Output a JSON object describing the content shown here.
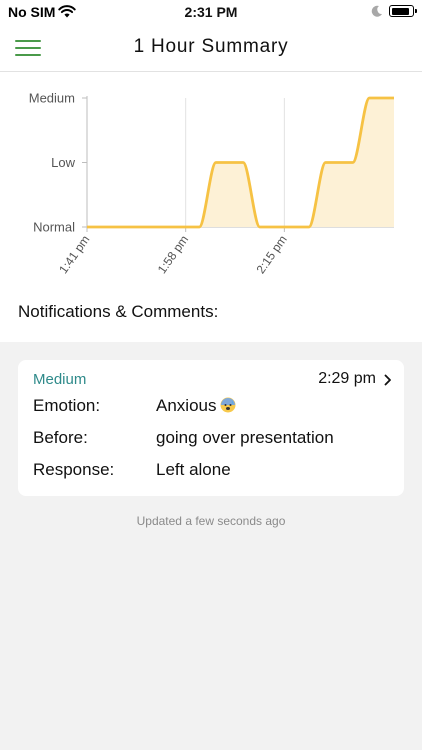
{
  "status_bar": {
    "carrier": "No SIM",
    "time": "2:31 PM",
    "icons": [
      "wifi-icon",
      "moon-icon",
      "battery-icon"
    ]
  },
  "nav": {
    "title": "1 Hour Summary",
    "menu_icon": "hamburger-menu-icon"
  },
  "colors": {
    "series": "#f6c244",
    "fill": "#fdf1d6",
    "accent_green": "#4a9a4a",
    "level_teal": "#2e8a8a",
    "background": "#f2f2f2"
  },
  "chart_data": {
    "type": "line",
    "y_levels": [
      "Normal",
      "Low",
      "Medium"
    ],
    "x_ticks": [
      "1:41 pm",
      "1:58 pm",
      "2:15 pm"
    ],
    "x": [
      0,
      1,
      2,
      3,
      4,
      5,
      6,
      7,
      8,
      9,
      10,
      11,
      12,
      13,
      14
    ],
    "values": [
      0,
      0,
      0,
      0,
      0,
      0,
      1,
      1,
      0,
      0,
      0,
      1,
      1,
      2,
      2
    ],
    "x_tick_positions": [
      0,
      4.5,
      9
    ],
    "ylim": [
      0,
      2
    ],
    "fill_under": true,
    "grid": "vertical"
  },
  "notifications": {
    "title": "Notifications & Comments:",
    "items": [
      {
        "level": "Medium",
        "time": "2:29 pm",
        "rows": [
          {
            "label": "Emotion:",
            "value": "Anxious",
            "emoji": "anxious-face-icon"
          },
          {
            "label": "Before:",
            "value": "going over presentation"
          },
          {
            "label": "Response:",
            "value": "Left alone"
          }
        ]
      }
    ]
  },
  "footer": {
    "updated": "Updated a few seconds ago"
  }
}
